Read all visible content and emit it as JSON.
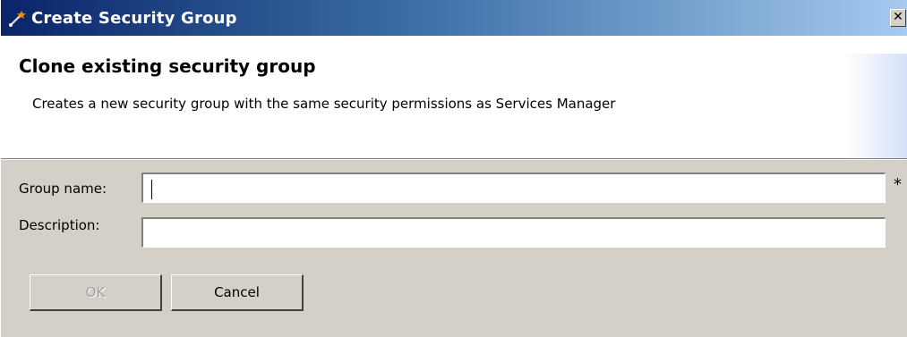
{
  "window": {
    "title": "Create Security Group",
    "close_glyph": "✕"
  },
  "banner": {
    "heading": "Clone existing security group",
    "description": "Creates a new security group with the same security permissions as Services Manager"
  },
  "form": {
    "group_name_label": "Group name:",
    "group_name_value": "",
    "required_marker": "*",
    "description_label": "Description:",
    "description_value": ""
  },
  "buttons": {
    "ok": "OK",
    "cancel": "Cancel"
  },
  "icons": {
    "app": "wizard-icon",
    "close": "close-icon"
  }
}
